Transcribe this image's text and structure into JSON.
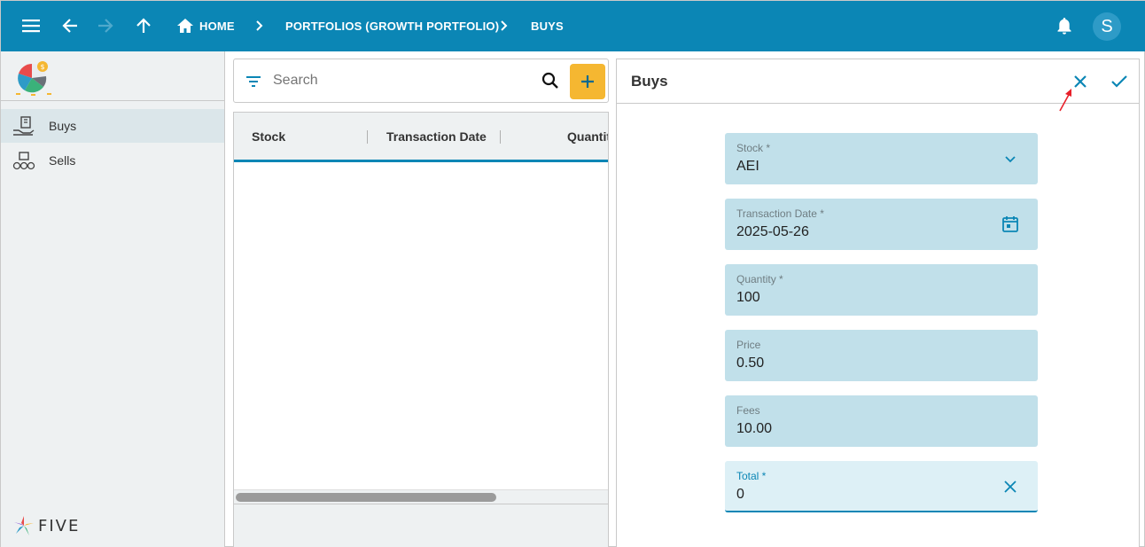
{
  "topbar": {
    "breadcrumbs": [
      {
        "label": "HOME"
      },
      {
        "label": "PORTFOLIOS (GROWTH PORTFOLIO)"
      },
      {
        "label": "BUYS"
      }
    ],
    "avatar_initial": "S",
    "icons": [
      "menu-icon",
      "arrow-back-icon",
      "arrow-forward-icon",
      "arrow-up-icon",
      "home-icon",
      "bell-icon"
    ]
  },
  "sidebar": {
    "items": [
      {
        "label": "Buys",
        "icon": "buys-icon",
        "active": true
      },
      {
        "label": "Sells",
        "icon": "sells-icon",
        "active": false
      }
    ],
    "brand": "FIVE"
  },
  "list": {
    "search_placeholder": "Search",
    "columns": [
      "Stock",
      "Transaction Date",
      "Quantit"
    ]
  },
  "form": {
    "title": "Buys",
    "fields": [
      {
        "label": "Stock *",
        "value": "AEI",
        "icon": "chevron-down-icon"
      },
      {
        "label": "Transaction Date *",
        "value": "2025-05-26",
        "icon": "calendar-icon"
      },
      {
        "label": "Quantity *",
        "value": "100"
      },
      {
        "label": "Price",
        "value": "0.50"
      },
      {
        "label": "Fees",
        "value": "10.00"
      },
      {
        "label": "Total *",
        "value": "0",
        "icon": "clear-icon",
        "focused": true
      }
    ]
  },
  "colors": {
    "primary": "#0b86b5",
    "accent": "#f5b731",
    "field_bg": "#c1e0ea",
    "annotation_arrow": "#e8202a"
  }
}
